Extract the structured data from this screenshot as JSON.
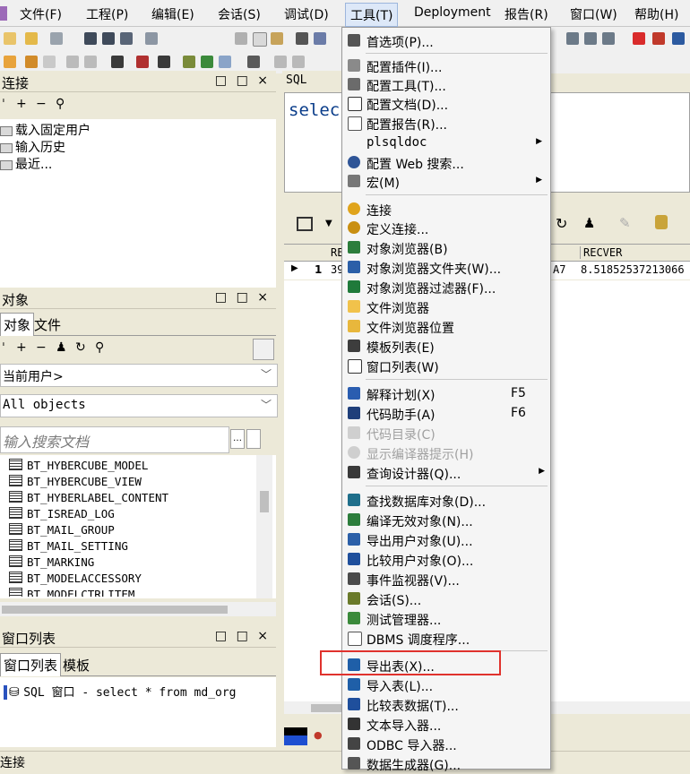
{
  "menubar": {
    "items": [
      {
        "label": "文件(F)"
      },
      {
        "label": "工程(P)"
      },
      {
        "label": "编辑(E)"
      },
      {
        "label": "会话(S)"
      },
      {
        "label": "调试(D)"
      },
      {
        "label": "工具(T)"
      },
      {
        "label": "Deployment"
      },
      {
        "label": "报告(R)"
      },
      {
        "label": "窗口(W)"
      },
      {
        "label": "帮助(H)"
      }
    ]
  },
  "connection_panel": {
    "title": "连接",
    "controls": "□ □ ×",
    "items": [
      "载入固定用户",
      "输入历史",
      "最近..."
    ]
  },
  "objects_panel": {
    "title": "对象",
    "controls": "□ □ ×",
    "tabs": [
      "对象",
      "文件"
    ],
    "user_combo": "当前用户>",
    "filter_combo": "All objects",
    "search_placeholder": "输入搜索文档",
    "rows": [
      "BT_HYBERCUBE_MODEL",
      "BT_HYBERCUBE_VIEW",
      "BT_HYBERLABEL_CONTENT",
      "BT_ISREAD_LOG",
      "BT_MAIL_GROUP",
      "BT_MAIL_SETTING",
      "BT_MARKING",
      "BT_MODELACCESSORY",
      "BT_MODELCTRLITEM"
    ]
  },
  "window_list_panel": {
    "title": "窗口列表",
    "controls": "□ □ ×",
    "tabs": [
      "窗口列表",
      "模板"
    ],
    "entries": [
      "SQL 窗口 - select * from md_org"
    ]
  },
  "sql_window": {
    "tab": "SQL",
    "editor_text": "selec",
    "grid": {
      "col1": "RE",
      "col_recver": "RECVER",
      "row_num": "1",
      "cell_partial": "39",
      "cell_mid": "A7",
      "cell_recver": "8.51852537213066"
    }
  },
  "tools_menu": {
    "items": [
      {
        "label": "首选项(P)...",
        "shortcut": "",
        "submenu": false,
        "disabled": false,
        "icon": "wrench-icon"
      },
      {
        "label": "配置插件(I)...",
        "shortcut": "",
        "submenu": false,
        "disabled": false,
        "icon": "plugin-icon"
      },
      {
        "label": "配置工具(T)...",
        "shortcut": "",
        "submenu": false,
        "disabled": false,
        "icon": "tools-icon"
      },
      {
        "label": "配置文档(D)...",
        "shortcut": "",
        "submenu": false,
        "disabled": false,
        "icon": "document-icon"
      },
      {
        "label": "配置报告(R)...",
        "shortcut": "",
        "submenu": false,
        "disabled": false,
        "icon": "report-icon"
      },
      {
        "label": "plsqldoc",
        "shortcut": "",
        "submenu": true,
        "disabled": false,
        "icon": ""
      },
      {
        "label": "配置 Web 搜索...",
        "shortcut": "",
        "submenu": false,
        "disabled": false,
        "icon": "search-icon"
      },
      {
        "label": "宏(M)",
        "shortcut": "",
        "submenu": true,
        "disabled": false,
        "icon": "macro-icon"
      },
      {
        "label": "连接",
        "shortcut": "",
        "submenu": false,
        "disabled": false,
        "icon": "database-icon"
      },
      {
        "label": "定义连接...",
        "shortcut": "",
        "submenu": false,
        "disabled": false,
        "icon": "database-gear-icon"
      },
      {
        "label": "对象浏览器(B)",
        "shortcut": "",
        "submenu": false,
        "disabled": false,
        "icon": "object-browser-icon"
      },
      {
        "label": "对象浏览器文件夹(W)...",
        "shortcut": "",
        "submenu": false,
        "disabled": false,
        "icon": "folder-icon"
      },
      {
        "label": "对象浏览器过滤器(F)...",
        "shortcut": "",
        "submenu": false,
        "disabled": false,
        "icon": "filter-icon"
      },
      {
        "label": "文件浏览器",
        "shortcut": "",
        "submenu": false,
        "disabled": false,
        "icon": "file-browser-icon"
      },
      {
        "label": "文件浏览器位置",
        "shortcut": "",
        "submenu": false,
        "disabled": false,
        "icon": "file-location-icon"
      },
      {
        "label": "模板列表(E)",
        "shortcut": "",
        "submenu": false,
        "disabled": false,
        "icon": "template-icon"
      },
      {
        "label": "窗口列表(W)",
        "shortcut": "",
        "submenu": false,
        "disabled": false,
        "icon": "window-list-icon"
      },
      {
        "label": "解释计划(X)",
        "shortcut": "F5",
        "submenu": false,
        "disabled": false,
        "icon": "explain-plan-icon"
      },
      {
        "label": "代码助手(A)",
        "shortcut": "F6",
        "submenu": false,
        "disabled": false,
        "icon": "code-assistant-icon"
      },
      {
        "label": "代码目录(C)",
        "shortcut": "",
        "submenu": false,
        "disabled": true,
        "icon": "code-contents-icon"
      },
      {
        "label": "显示编译器提示(H)",
        "shortcut": "",
        "submenu": false,
        "disabled": true,
        "icon": "compiler-hint-icon"
      },
      {
        "label": "查询设计器(Q)...",
        "shortcut": "",
        "submenu": true,
        "disabled": false,
        "icon": "query-designer-icon"
      },
      {
        "label": "查找数据库对象(D)...",
        "shortcut": "",
        "submenu": false,
        "disabled": false,
        "icon": "find-object-icon"
      },
      {
        "label": "编译无效对象(N)...",
        "shortcut": "",
        "submenu": false,
        "disabled": false,
        "icon": "compile-icon"
      },
      {
        "label": "导出用户对象(U)...",
        "shortcut": "",
        "submenu": false,
        "disabled": false,
        "icon": "export-user-icon"
      },
      {
        "label": "比较用户对象(O)...",
        "shortcut": "",
        "submenu": false,
        "disabled": false,
        "icon": "compare-icon"
      },
      {
        "label": "事件监视器(V)...",
        "shortcut": "",
        "submenu": false,
        "disabled": false,
        "icon": "monitor-icon"
      },
      {
        "label": "会话(S)...",
        "shortcut": "",
        "submenu": false,
        "disabled": false,
        "icon": "session-icon"
      },
      {
        "label": "测试管理器...",
        "shortcut": "",
        "submenu": false,
        "disabled": false,
        "icon": "test-manager-icon"
      },
      {
        "label": "DBMS 调度程序...",
        "shortcut": "",
        "submenu": false,
        "disabled": false,
        "icon": "scheduler-icon"
      },
      {
        "label": "导出表(X)...",
        "shortcut": "",
        "submenu": false,
        "disabled": false,
        "icon": "export-table-icon"
      },
      {
        "label": "导入表(L)...",
        "shortcut": "",
        "submenu": false,
        "disabled": false,
        "icon": "import-table-icon"
      },
      {
        "label": "比较表数据(T)...",
        "shortcut": "",
        "submenu": false,
        "disabled": false,
        "icon": "compare-table-icon"
      },
      {
        "label": "文本导入器...",
        "shortcut": "",
        "submenu": false,
        "disabled": false,
        "icon": "text-importer-icon"
      },
      {
        "label": "ODBC 导入器...",
        "shortcut": "",
        "submenu": false,
        "disabled": false,
        "icon": "odbc-importer-icon"
      },
      {
        "label": "数据生成器(G)...",
        "shortcut": "",
        "submenu": false,
        "disabled": false,
        "icon": "data-generator-icon"
      }
    ],
    "highlighted_item": "导出表(X)...",
    "highlight_color": "#e0322d"
  },
  "status_bar": {
    "text": "连接"
  }
}
